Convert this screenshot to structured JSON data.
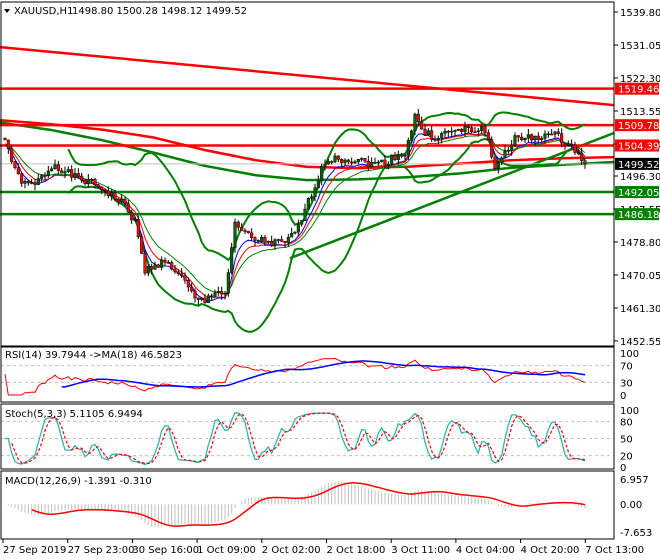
{
  "header": {
    "symbol": "XAUUSD,H1",
    "ohlc": "1498.80 1500.28 1498.12 1499.52"
  },
  "colors": {
    "bull": "#006400",
    "bear": "#ff0000",
    "band": "#008000",
    "resistance": "#ff0000",
    "support": "#008000",
    "rsi": "#ff0000",
    "rsi_ma": "#0000ff",
    "stoch_main": "#20b2aa",
    "stoch_signal": "#ff0000",
    "macd_hist": "#c0c0c0",
    "macd_signal": "#ff0000"
  },
  "price_axis": [
    "1539.80",
    "1531.05",
    "1522.30",
    "1513.55",
    "1504.80",
    "1496.30",
    "1487.55",
    "1478.80",
    "1470.05",
    "1461.30",
    "1452.55"
  ],
  "levels": [
    {
      "value": 1519.46,
      "label": "1519.46",
      "color": "#ff0000"
    },
    {
      "value": 1509.78,
      "label": "1509.78",
      "color": "#ff0000"
    },
    {
      "value": 1504.39,
      "label": "1504.39",
      "color": "#ff0000"
    },
    {
      "value": 1492.05,
      "label": "1492.05",
      "color": "#008000"
    },
    {
      "value": 1486.18,
      "label": "1486.18",
      "color": "#008000"
    }
  ],
  "current_price": {
    "value": 1499.52,
    "label": "1499.52"
  },
  "rsi": {
    "label": "RSI(14) 39.7944  ->MA(18) 46.5823",
    "levels": [
      "100",
      "70",
      "30",
      "0"
    ]
  },
  "stoch": {
    "label": "Stoch(5,3,3) 5.1105 6.9494",
    "levels": [
      "100",
      "80",
      "50",
      "20",
      "0"
    ]
  },
  "macd": {
    "label": "MACD(12,26,9) -1.391 -0.310",
    "levels": [
      "6.957",
      "0.00",
      "-7.653"
    ]
  },
  "time_labels": [
    "27 Sep 2019",
    "27 Sep 23:00",
    "30 Sep 16:00",
    "1 Oct 09:00",
    "2 Oct 02:00",
    "2 Oct 18:00",
    "3 Oct 11:00",
    "4 Oct 04:00",
    "4 Oct 20:00",
    "7 Oct 13:00"
  ],
  "chart_data": {
    "type": "candlestick",
    "title": "XAUUSD,H1",
    "ylim": [
      1452.55,
      1539.8
    ],
    "close_keypoints": [
      1506.4,
      1497.5,
      1494,
      1494,
      1497,
      1499.5,
      1497.4,
      1496,
      1495,
      1494,
      1492.5,
      1490.5,
      1488.5,
      1484,
      1471,
      1473,
      1473.3,
      1471.5,
      1468,
      1463.5,
      1463,
      1466,
      1465,
      1483,
      1481,
      1479.3,
      1479,
      1478.5,
      1478.5,
      1481,
      1487,
      1494,
      1500,
      1501.5,
      1500.7,
      1500.5,
      1500,
      1499.5,
      1500,
      1501.5,
      1502.5,
      1512,
      1507.5,
      1506.8,
      1507.5,
      1508.2,
      1508.5,
      1508.5,
      1508.8,
      1498,
      1503,
      1506,
      1506.2,
      1506.6,
      1507.2,
      1507,
      1505.5,
      1503,
      1499.5
    ],
    "slow_ma_red": [
      1511.1,
      1510,
      1508.6,
      1506.5,
      1503.2,
      1500.5,
      1498.7,
      1498.4,
      1498.8,
      1499.6,
      1500.5,
      1501,
      1501.3
    ],
    "slow_ma_green": [
      1510.5,
      1508.5,
      1505.8,
      1502.5,
      1499,
      1496.5,
      1495.2,
      1495.4,
      1496,
      1497,
      1498.5,
      1499.3,
      1500
    ],
    "trendlines": [
      {
        "name": "resistance-trendline",
        "from": 1530.5,
        "to": 1515.1,
        "color": "#ff0000"
      },
      {
        "name": "support-trendline",
        "from": 1474.5,
        "to": 1507.7,
        "color": "#008000"
      }
    ]
  }
}
